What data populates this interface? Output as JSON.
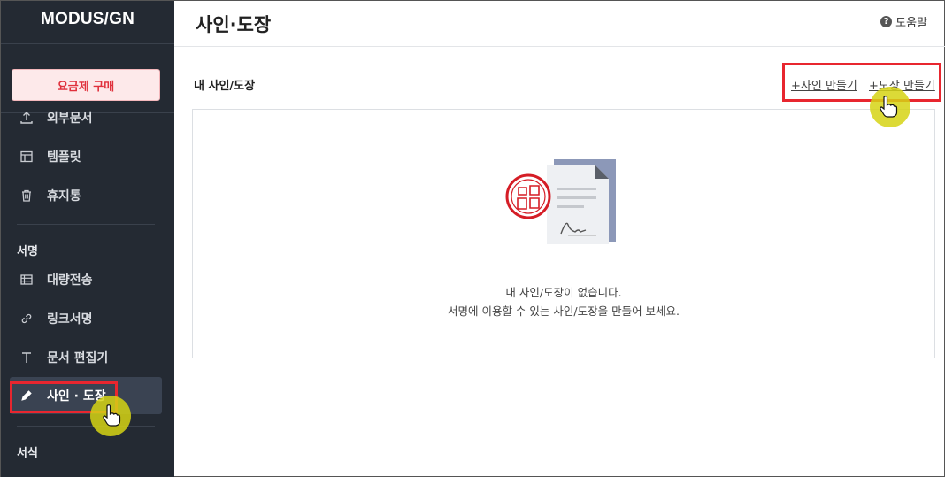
{
  "app": {
    "logo": "MODUS/GN"
  },
  "sidebar": {
    "buy_label": "요금제 구매",
    "items_top": [
      {
        "label": "외부문서",
        "icon": "upload-icon"
      },
      {
        "label": "템플릿",
        "icon": "template-icon"
      },
      {
        "label": "휴지통",
        "icon": "trash-icon"
      }
    ],
    "section_sign": "서명",
    "items_sign": [
      {
        "label": "대량전송",
        "icon": "bulk-send-icon"
      },
      {
        "label": "링크서명",
        "icon": "link-icon"
      },
      {
        "label": "문서 편집기",
        "icon": "text-icon"
      },
      {
        "label": "사인 · 도장",
        "icon": "pen-icon",
        "active": true
      }
    ],
    "section_form": "서식"
  },
  "header": {
    "title": "사인·도장",
    "help_label": "도움말"
  },
  "main": {
    "section_title": "내 사인/도장",
    "create_sign_label": "+사인 만들기",
    "create_stamp_label": "+도장 만들기",
    "empty_title": "내 사인/도장이 없습니다.",
    "empty_desc": "서명에 이용할 수 있는 사인/도장을 만들어 보세요."
  },
  "colors": {
    "sidebar_bg": "#242a33",
    "highlight_red": "#e8262f",
    "cursor_halo": "#d6d414",
    "buy_text": "#e0303c"
  }
}
